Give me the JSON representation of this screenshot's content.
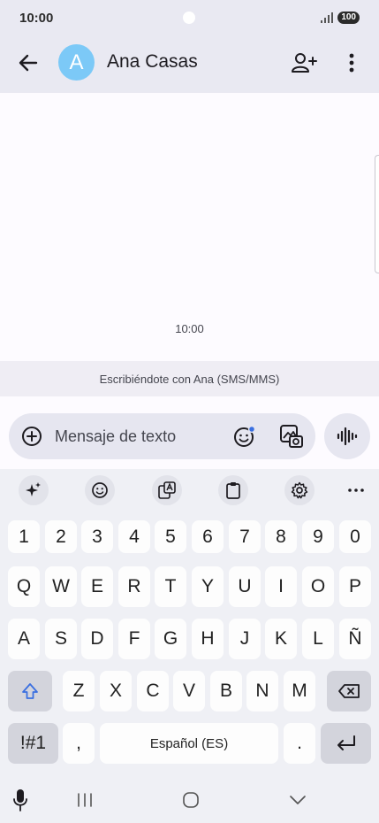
{
  "status_bar": {
    "time": "10:00",
    "battery": "100"
  },
  "header": {
    "avatar_letter": "A",
    "contact_name": "Ana Casas"
  },
  "conversation": {
    "timestamp": "10:00"
  },
  "notice": {
    "text": "Escribiéndote con Ana (SMS/MMS)"
  },
  "compose": {
    "placeholder": "Mensaje de texto"
  },
  "keyboard": {
    "row_numbers": [
      "1",
      "2",
      "3",
      "4",
      "5",
      "6",
      "7",
      "8",
      "9",
      "0"
    ],
    "row_1": [
      "Q",
      "W",
      "E",
      "R",
      "T",
      "Y",
      "U",
      "I",
      "O",
      "P"
    ],
    "row_2": [
      "A",
      "S",
      "D",
      "F",
      "G",
      "H",
      "J",
      "K",
      "L",
      "Ñ"
    ],
    "row_3": [
      "Z",
      "X",
      "C",
      "V",
      "B",
      "N",
      "M"
    ],
    "symbols_label": "!#1",
    "comma": ",",
    "space_label": "Español (ES)",
    "period": "."
  },
  "icons": {
    "back": "arrow-left-icon",
    "add_person": "person-add-icon",
    "more": "more-vertical-icon",
    "plus": "plus-circle-icon",
    "emoji": "emoji-icon",
    "gallery": "gallery-icon",
    "voice": "waveform-icon"
  },
  "colors": {
    "avatar": "#7cc9f7",
    "header_bg": "#e9e9f2",
    "shift_accent": "#3a6fe0"
  }
}
